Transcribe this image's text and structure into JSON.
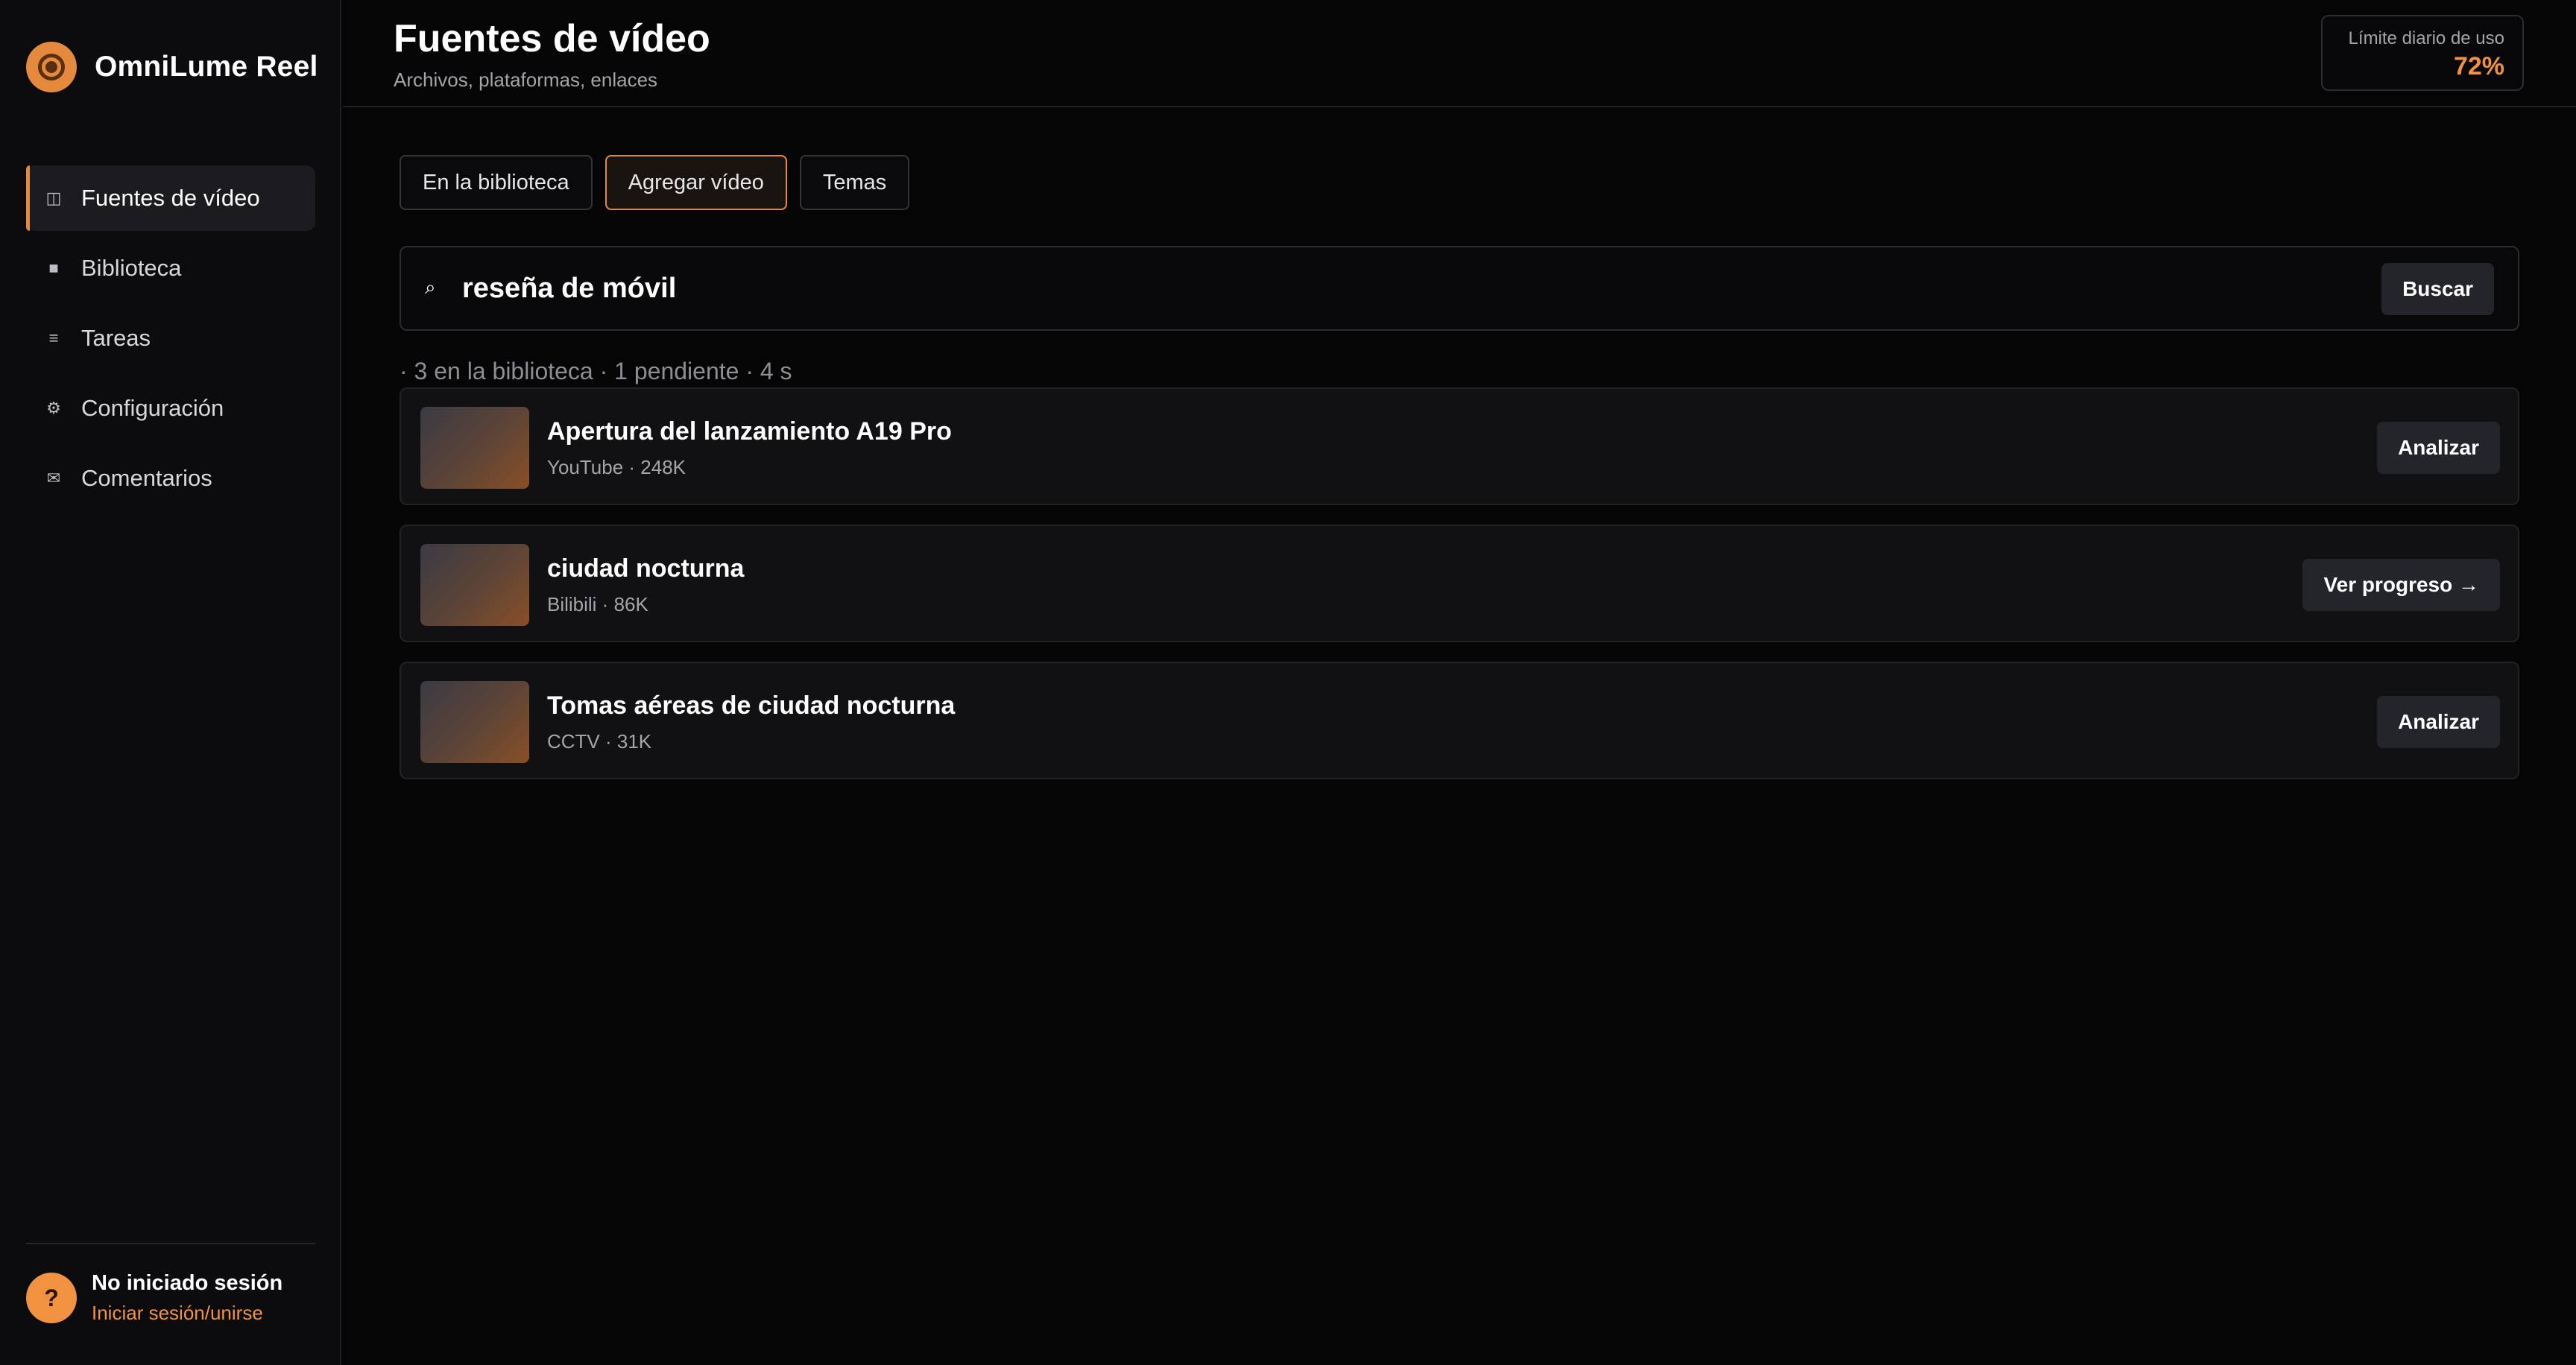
{
  "app": {
    "name": "OmniLume Reel"
  },
  "sidebar": {
    "items": [
      {
        "label": "Fuentes de vídeo",
        "icon": "panels-icon",
        "glyph": "◫",
        "active": true
      },
      {
        "label": "Biblioteca",
        "icon": "square-icon",
        "glyph": "■",
        "active": false
      },
      {
        "label": "Tareas",
        "icon": "list-icon",
        "glyph": "≡",
        "active": false
      },
      {
        "label": "Configuración",
        "icon": "gear-icon",
        "glyph": "⚙",
        "active": false
      },
      {
        "label": "Comentarios",
        "icon": "mail-icon",
        "glyph": "✉",
        "active": false
      }
    ],
    "user": {
      "avatar": "?",
      "name": "No iniciado sesión",
      "link": "Iniciar sesión/unirse"
    }
  },
  "header": {
    "title": "Fuentes de vídeo",
    "subtitle": "Archivos, plataformas, enlaces",
    "quota_label": "Límite diario de uso",
    "quota_value": "72%"
  },
  "tabs": [
    {
      "label": "En la biblioteca",
      "active": false
    },
    {
      "label": "Agregar vídeo",
      "active": true
    },
    {
      "label": "Temas",
      "active": false
    }
  ],
  "search": {
    "icon": "⌕",
    "value": "reseña de móvil",
    "button": "Buscar"
  },
  "results_meta": "· 3 en la biblioteca · 1 pendiente · 4 s",
  "results": [
    {
      "title": "Apertura del lanzamiento A19 Pro",
      "subtitle": "YouTube · 248K",
      "action": "Analizar"
    },
    {
      "title": "ciudad nocturna",
      "subtitle": "Bilibili · 86K",
      "action": "Ver progreso →"
    },
    {
      "title": "Tomas aéreas de ciudad nocturna",
      "subtitle": "CCTV · 31K",
      "action": "Analizar"
    }
  ],
  "colors": {
    "accent": "#e58a3c",
    "accent_text": "#f0923f",
    "background": "#050506",
    "sidebar": "#0c0c0f",
    "card": "#111114"
  }
}
